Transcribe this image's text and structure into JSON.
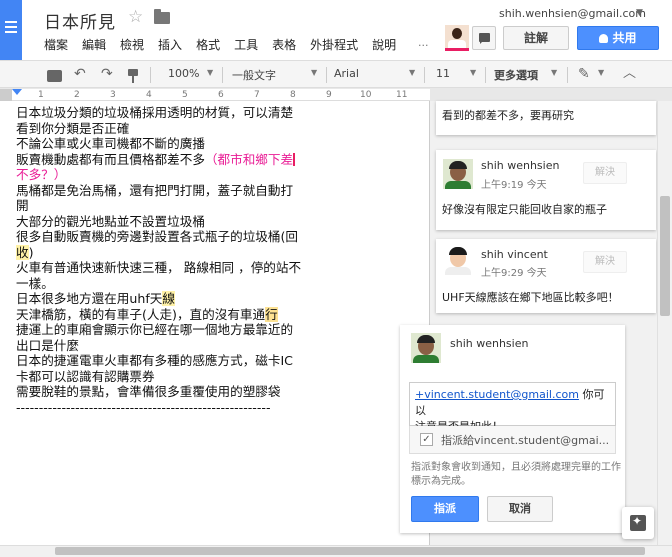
{
  "header": {
    "title": "日本所見",
    "account_email": "shih.wenhsien@gmail.com",
    "menu": [
      "檔案",
      "編輯",
      "檢視",
      "插入",
      "格式",
      "工具",
      "表格",
      "外掛程式",
      "說明"
    ],
    "menu_more": "...",
    "comment_button": "註解",
    "share_button": "共用"
  },
  "toolbar": {
    "zoom": "100%",
    "style": "一般文字",
    "font": "Arial",
    "size": "11",
    "more": "更多選項"
  },
  "ruler": [
    "1",
    "2",
    "3",
    "4",
    "5",
    "6",
    "7",
    "8",
    "9",
    "10",
    "11"
  ],
  "document": {
    "l1": "日本垃圾分類的垃圾桶採用透明的材質，可以清楚",
    "l2": "看到你分類是否正確",
    "l3": "不論公車或火車司機都不斷的廣播",
    "l4a": "販賣機動處都有而且價格都差不多",
    "l4b": "（都市和鄉下差",
    "l5": "不多？）",
    "l6": "馬桶都是免治馬桶，還有把門打開，蓋子就自動打",
    "l7": "開",
    "l8": "大部分的觀光地點並不設置垃圾桶",
    "l9": "很多自動販賣機的旁邊對設置各式瓶子的垃圾桶(回",
    "l10": "收",
    "l10b": ")",
    "l11": "火車有普通快速新快速三種， 路線相同 ，停的站不",
    "l12": "一樣。",
    "l13a": "日本很多地方還在用uh",
    "l13b": "f天",
    "l13c": "線",
    "l14a": "天津橋筋，橫的有車子(人走)，直的沒有車通",
    "l14b": "行",
    "l15": "捷運上的車廂會顯示你已經在哪一個地方最靠近的",
    "l16": "出口是什麼",
    "l17": "日本的捷運電車火車都有多種的感應方式，磁卡IC",
    "l18": "卡都可以認識有認購票券",
    "l19": "需要脫鞋的景點，會準備很多重覆使用的塑膠袋",
    "l20": "--------------------------------------------------------"
  },
  "comments": {
    "top_fragment": "看到的都差不多，要再研究",
    "c1": {
      "author": "shih wenhsien",
      "time": "上午9:19 今天",
      "resolve": "解決",
      "text": "好像沒有限定只能回收自家的瓶子"
    },
    "c2": {
      "author": "shih vincent",
      "time": "上午9:29 今天",
      "resolve": "解決",
      "text": "UHF天線應該在鄉下地區比較多吧！"
    },
    "new_comment": {
      "author": "shih wenhsien",
      "mention": "+vincent.student@gmail.com",
      "text_after_mention": " 你可以",
      "text_line2": "注意是否是如此！",
      "assign_label": "指派給vincent.student@gmai...",
      "assign_checked": true,
      "note": "指派對象會收到通知，且必須將處理完畢的工作標示為完成。",
      "assign_button": "指派",
      "cancel_button": "取消"
    }
  },
  "colors": {
    "accent_blue": "#4d90fe",
    "docs_blue": "#4285f4",
    "pink_text": "#e91e96",
    "highlight": "#fff2a8"
  }
}
